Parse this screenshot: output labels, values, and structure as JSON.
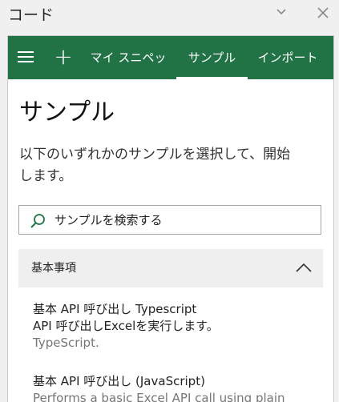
{
  "window": {
    "title": "コード"
  },
  "nav": {
    "tabs": [
      {
        "label": "マイ スニペット",
        "active": false
      },
      {
        "label": "サンプル",
        "active": true
      },
      {
        "label": "インポート",
        "active": false
      }
    ],
    "color": "#217346"
  },
  "main": {
    "heading": "サンプル",
    "description": "以下のいずれかのサンプルを選択して、開始します。",
    "search_placeholder": "サンプルを検索する",
    "group": {
      "label": "基本事項",
      "expanded": true
    },
    "items": [
      {
        "name": "基本 API 呼び出し Typescript",
        "description_line1": "API 呼び出しExcelを実行します。",
        "description_line2": "TypeScript."
      },
      {
        "name": "基本 API 呼び出し (JavaScript)",
        "description_line1": "Performs a basic Excel API call using plain"
      }
    ]
  }
}
